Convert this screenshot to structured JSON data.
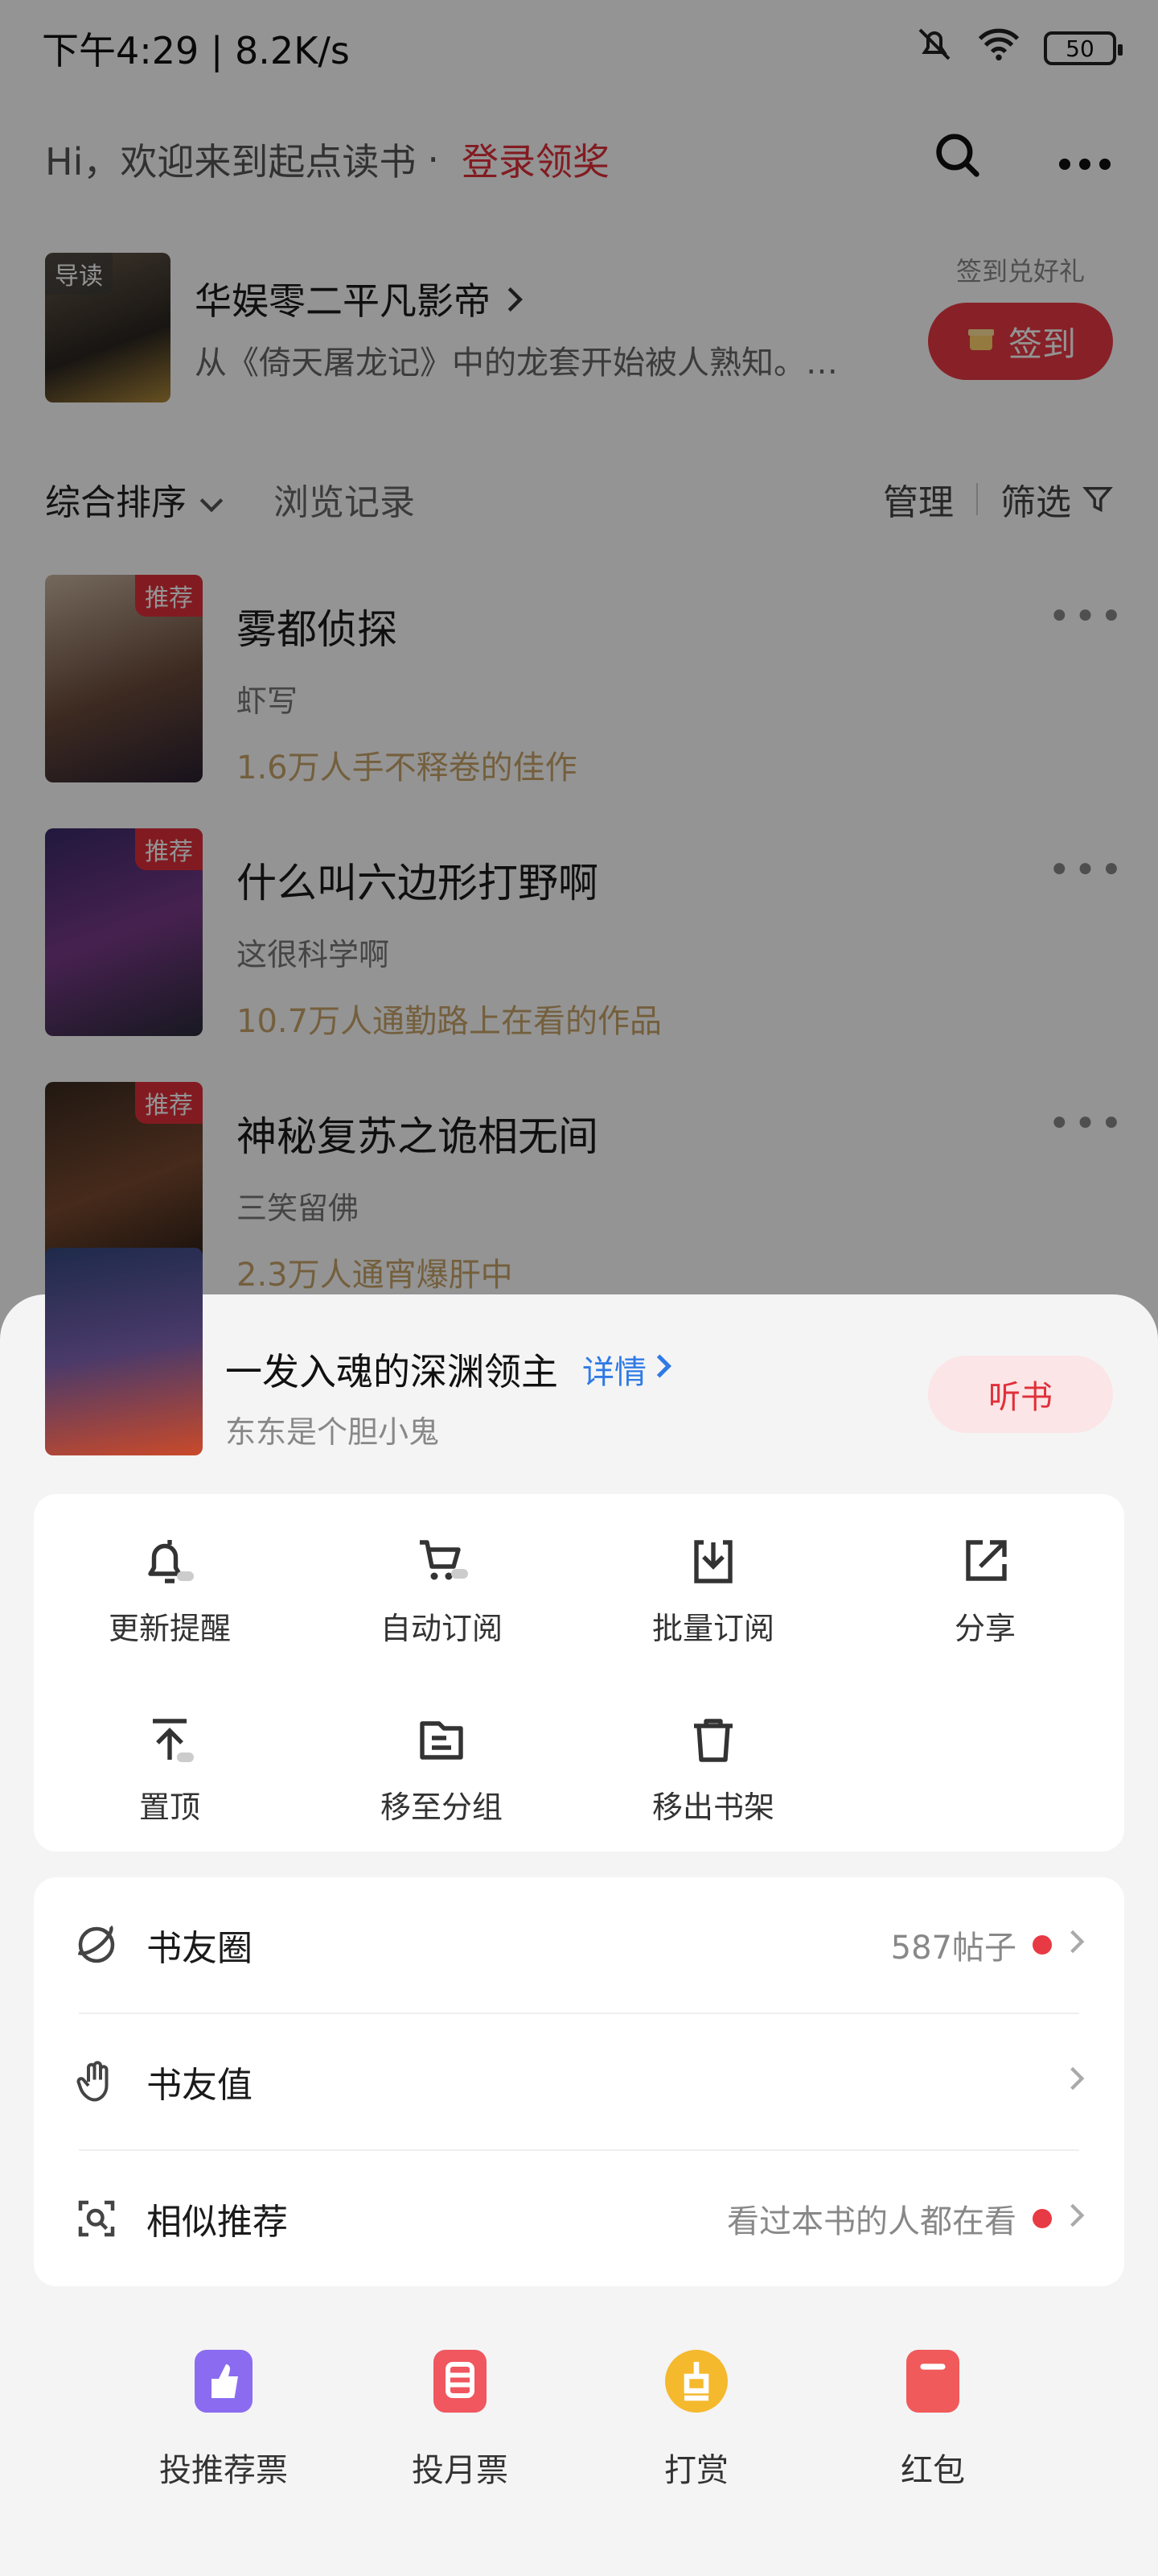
{
  "status_bar": {
    "time": "下午4:29 | 8.2K/s",
    "battery": "50"
  },
  "header": {
    "greeting": "Hi，欢迎来到起点读书",
    "dot": "·",
    "login_link": "登录领奖"
  },
  "guide": {
    "tag": "导读",
    "title": "华娱零二平凡影帝",
    "desc": "从《倚天屠龙记》中的龙套开始被人熟知。…",
    "sign_hint": "签到兑好礼",
    "sign_button": "签到"
  },
  "filter": {
    "sort": "综合排序",
    "history": "浏览记录",
    "manage": "管理",
    "filter": "筛选"
  },
  "books": [
    {
      "tag": "推荐",
      "name": "雾都侦探",
      "author": "虾写",
      "stat": "1.6万人手不释卷的佳作"
    },
    {
      "tag": "推荐",
      "name": "什么叫六边形打野啊",
      "author": "这很科学啊",
      "stat": "10.7万人通勤路上在看的作品"
    },
    {
      "tag": "推荐",
      "name": "神秘复苏之诡相无间",
      "author": "三笑留佛",
      "stat": "2.3万人通宵爆肝中"
    }
  ],
  "sheet": {
    "book_title": "一发入魂的深渊领主",
    "detail_link": "详情",
    "book_author": "东东是个胆小鬼",
    "listen_button": "听书",
    "operations": [
      {
        "label": "更新提醒",
        "icon": "bell-icon"
      },
      {
        "label": "自动订阅",
        "icon": "cart-icon"
      },
      {
        "label": "批量订阅",
        "icon": "download-icon"
      },
      {
        "label": "分享",
        "icon": "share-icon"
      },
      {
        "label": "置顶",
        "icon": "pin-top-icon"
      },
      {
        "label": "移至分组",
        "icon": "folder-icon"
      },
      {
        "label": "移出书架",
        "icon": "trash-icon"
      }
    ],
    "links": [
      {
        "label": "书友圈",
        "value": "587帖子",
        "icon": "planet-icon"
      },
      {
        "label": "书友值",
        "value": "",
        "icon": "hand-icon"
      },
      {
        "label": "相似推荐",
        "value": "看过本书的人都在看",
        "icon": "scan-icon"
      }
    ],
    "rewards": [
      {
        "label": "投推荐票",
        "icon": "thumb-ticket-icon",
        "color": "#8b6cf0"
      },
      {
        "label": "投月票",
        "icon": "month-ticket-icon",
        "color": "#f0575f"
      },
      {
        "label": "打赏",
        "icon": "coin-icon",
        "color": "#f5b92e"
      },
      {
        "label": "红包",
        "icon": "red-packet-icon",
        "color": "#f05a5a"
      }
    ]
  }
}
